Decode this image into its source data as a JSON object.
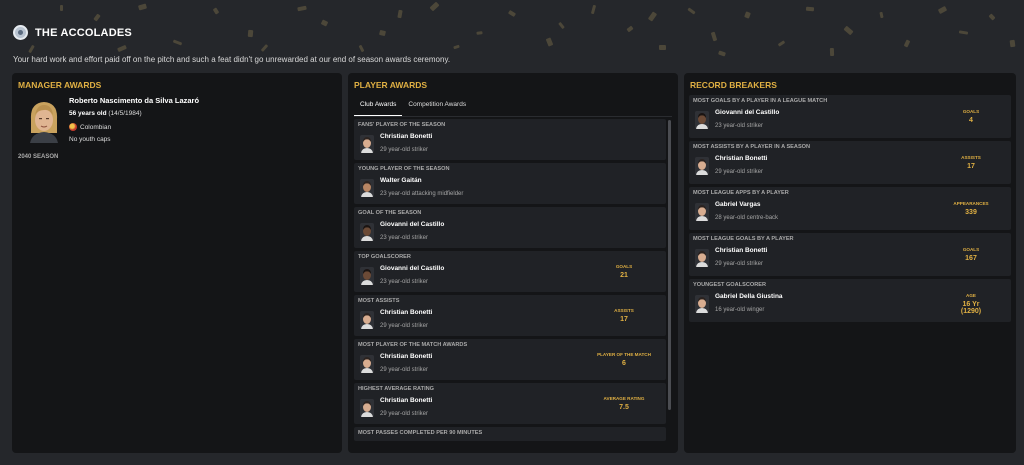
{
  "header": {
    "title": "THE ACCOLADES",
    "subtitle": "Your hard work and effort paid off on the pitch and such a feat didn't go unrewarded at our end of season awards ceremony."
  },
  "manager_awards": {
    "title": "MANAGER AWARDS",
    "name": "Roberto Nascimento da Silva Lazaró",
    "age_bold": "56 years old",
    "dob": "(14/5/1984)",
    "nationality": "Colombian",
    "caps": "No youth caps",
    "season": "2040 SEASON"
  },
  "player_awards": {
    "title": "PLAYER AWARDS",
    "tabs": [
      "Club Awards",
      "Competition Awards"
    ],
    "active_tab": "Club Awards",
    "awards": [
      {
        "heading": "FANS' PLAYER OF THE SEASON",
        "player": "Christian Bonetti",
        "desc": "29 year-old striker",
        "stat_label": "",
        "stat_value": ""
      },
      {
        "heading": "YOUNG PLAYER OF THE SEASON",
        "player": "Walter Gaitán",
        "desc": "23 year-old attacking midfielder",
        "stat_label": "",
        "stat_value": ""
      },
      {
        "heading": "GOAL OF THE SEASON",
        "player": "Giovanni del Castillo",
        "desc": "23 year-old striker",
        "stat_label": "",
        "stat_value": ""
      },
      {
        "heading": "TOP GOALSCORER",
        "player": "Giovanni del Castillo",
        "desc": "23 year-old striker",
        "stat_label": "GOALS",
        "stat_value": "21"
      },
      {
        "heading": "MOST ASSISTS",
        "player": "Christian Bonetti",
        "desc": "29 year-old striker",
        "stat_label": "ASSISTS",
        "stat_value": "17"
      },
      {
        "heading": "MOST PLAYER OF THE MATCH AWARDS",
        "player": "Christian Bonetti",
        "desc": "29 year-old striker",
        "stat_label": "PLAYER OF THE MATCH",
        "stat_value": "6"
      },
      {
        "heading": "HIGHEST AVERAGE RATING",
        "player": "Christian Bonetti",
        "desc": "29 year-old striker",
        "stat_label": "AVERAGE RATING",
        "stat_value": "7.5"
      },
      {
        "heading": "MOST PASSES COMPLETED PER 90 MINUTES",
        "player": "",
        "desc": "",
        "stat_label": "",
        "stat_value": ""
      }
    ]
  },
  "record_breakers": {
    "title": "RECORD BREAKERS",
    "records": [
      {
        "heading": "MOST GOALS BY A PLAYER IN A LEAGUE MATCH",
        "player": "Giovanni del Castillo",
        "desc": "23 year-old striker",
        "stat_label": "GOALS",
        "stat_value": "4"
      },
      {
        "heading": "MOST ASSISTS BY A PLAYER IN A SEASON",
        "player": "Christian Bonetti",
        "desc": "29 year-old striker",
        "stat_label": "ASSISTS",
        "stat_value": "17"
      },
      {
        "heading": "MOST LEAGUE APPS BY A PLAYER",
        "player": "Gabriel Vargas",
        "desc": "28 year-old centre-back",
        "stat_label": "APPEARANCES",
        "stat_value": "339"
      },
      {
        "heading": "MOST LEAGUE GOALS BY A PLAYER",
        "player": "Christian Bonetti",
        "desc": "29 year-old striker",
        "stat_label": "GOALS",
        "stat_value": "167"
      },
      {
        "heading": "YOUNGEST GOALSCORER",
        "player": "Gabriel Della Giustina",
        "desc": "16 year-old winger",
        "stat_label": "AGE",
        "stat_value": "16 Yr",
        "stat_value2": "(1290)"
      }
    ]
  },
  "colors": {
    "accent": "#e0b043",
    "background": "#25272b",
    "panel": "#141517",
    "card": "#202226"
  },
  "icons": {
    "logo": "club-crest-icon",
    "flag": "colombia-flag-icon",
    "player": "player-face-icon"
  }
}
